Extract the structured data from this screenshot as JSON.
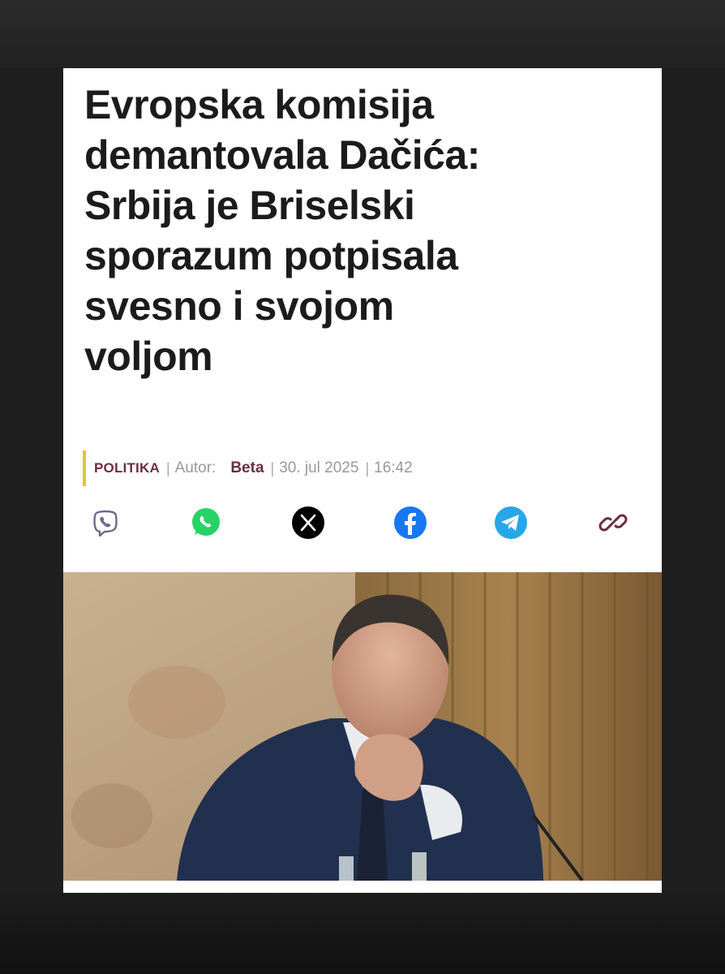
{
  "article": {
    "headline_lines": [
      "Evropska komisija",
      "demantovala Dačića:",
      "Srbija je Briselski",
      "sporazum potpisala",
      "svesno i svojom",
      "voljom"
    ],
    "category": "POLITIKA",
    "author_label": "Autor:",
    "author": "Beta",
    "date": "30. jul 2025",
    "time": "16:42"
  },
  "share": [
    {
      "icon": "viber-icon",
      "color": "#7360f2"
    },
    {
      "icon": "whatsapp-icon",
      "color": "#25d366"
    },
    {
      "icon": "x-icon",
      "color": "#000000"
    },
    {
      "icon": "facebook-icon",
      "color": "#1877f2"
    },
    {
      "icon": "telegram-icon",
      "color": "#27a7e7"
    },
    {
      "icon": "link-icon",
      "color": "#6b2e3e"
    }
  ],
  "colors": {
    "accent_bar": "#e5c431",
    "category": "#6b2e3e"
  }
}
